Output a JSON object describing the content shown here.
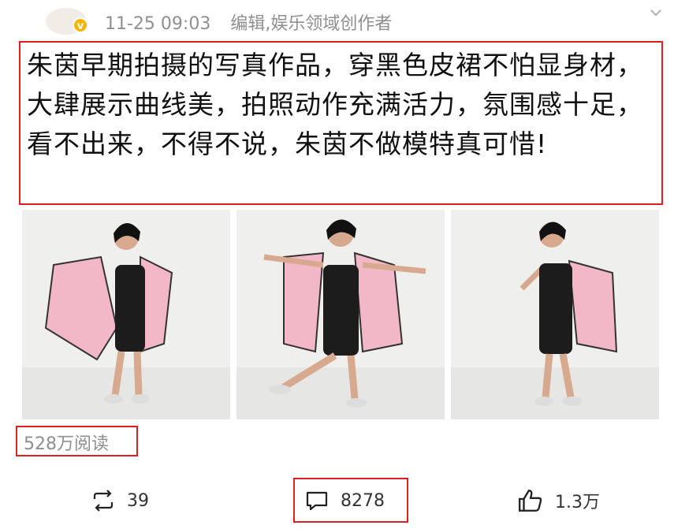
{
  "header": {
    "timestamp": "11-25 09:03",
    "source": "编辑,娱乐领域创作者",
    "badge": "v"
  },
  "post": {
    "text": "朱茵早期拍摄的写真作品，穿黑色皮裙不怕显身材，大肆展示曲线美，拍照动作充满活力，氛围感十足，看不出来，不得不说，朱茵不做模特真可惜!"
  },
  "stats": {
    "reads": "528万阅读"
  },
  "actions": {
    "repost_count": "39",
    "comment_count": "8278",
    "like_count": "1.3万"
  },
  "colors": {
    "highlight_border": "#e02020",
    "meta_text": "#8f8f8f",
    "badge": "#f5b400"
  },
  "icons": [
    "chevron-down-icon",
    "verified-badge-icon",
    "repost-icon",
    "comment-icon",
    "like-icon"
  ]
}
